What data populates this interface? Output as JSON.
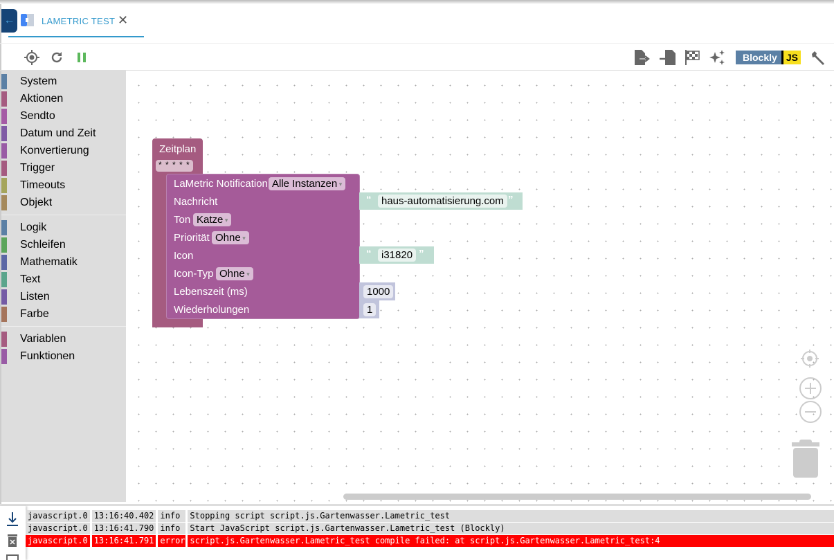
{
  "tab": {
    "title": "LAMETRIC TEST",
    "close": "✕",
    "back": "←"
  },
  "toolbar": {
    "left": [
      "target-icon",
      "reload-icon",
      "pause-icon"
    ],
    "right": [
      "export-icon",
      "import-icon",
      "flag-icon",
      "sparkle-icon",
      "blockly-js-badge",
      "wrench-icon"
    ],
    "blockly": "Blockly",
    "js": "JS"
  },
  "toolbox": [
    {
      "label": "System",
      "color": "#5b80a5"
    },
    {
      "label": "Aktionen",
      "color": "#a55b80"
    },
    {
      "label": "Sendto",
      "color": "#a55ba5"
    },
    {
      "label": "Datum und Zeit",
      "color": "#805ba5"
    },
    {
      "label": "Konvertierung",
      "color": "#995ba5"
    },
    {
      "label": "Trigger",
      "color": "#a55b80"
    },
    {
      "label": "Timeouts",
      "color": "#a5a55b"
    },
    {
      "label": "Objekt",
      "color": "#a5895b"
    },
    {
      "label": "Logik",
      "color": "#5b80a5"
    },
    {
      "label": "Schleifen",
      "color": "#5ba55b"
    },
    {
      "label": "Mathematik",
      "color": "#5b67a5"
    },
    {
      "label": "Text",
      "color": "#5ba58c"
    },
    {
      "label": "Listen",
      "color": "#745ba5"
    },
    {
      "label": "Farbe",
      "color": "#a5745b"
    },
    {
      "label": "Variablen",
      "color": "#a55b80"
    },
    {
      "label": "Funktionen",
      "color": "#995ba5"
    }
  ],
  "blocks": {
    "schedule": {
      "title": "Zeitplan",
      "cron": "* * * * *",
      "color": "#a55b80"
    },
    "notify": {
      "color": "#a55b99",
      "title": "LaMetric Notification",
      "instance": "Alle Instanzen",
      "message_label": "Nachricht",
      "sound_label": "Ton",
      "sound": "Katze",
      "priority_label": "Priorität",
      "priority": "Ohne",
      "icon_label": "Icon",
      "icontype_label": "Icon-Typ",
      "icontype": "Ohne",
      "lifetime_label": "Lebenszeit (ms)",
      "repeat_label": "Wiederholungen"
    },
    "message": "haus-automatisierung.com",
    "icon": "i31820",
    "lifetime": "1000",
    "repeat": "1",
    "open_quote": "“",
    "close_quote": "”"
  },
  "log": [
    {
      "source": "javascript.0",
      "time": "13:16:40.402",
      "level": "info",
      "message": "Stopping script script.js.Gartenwasser.Lametric_test"
    },
    {
      "source": "javascript.0",
      "time": "13:16:41.790",
      "level": "info",
      "message": "Start JavaScript script.js.Gartenwasser.Lametric_test (Blockly)"
    },
    {
      "source": "javascript.0",
      "time": "13:16:41.791",
      "level": "error",
      "message": "script.js.Gartenwasser.Lametric_test compile failed: at script.js.Gartenwasser.Lametric_test:4"
    }
  ]
}
